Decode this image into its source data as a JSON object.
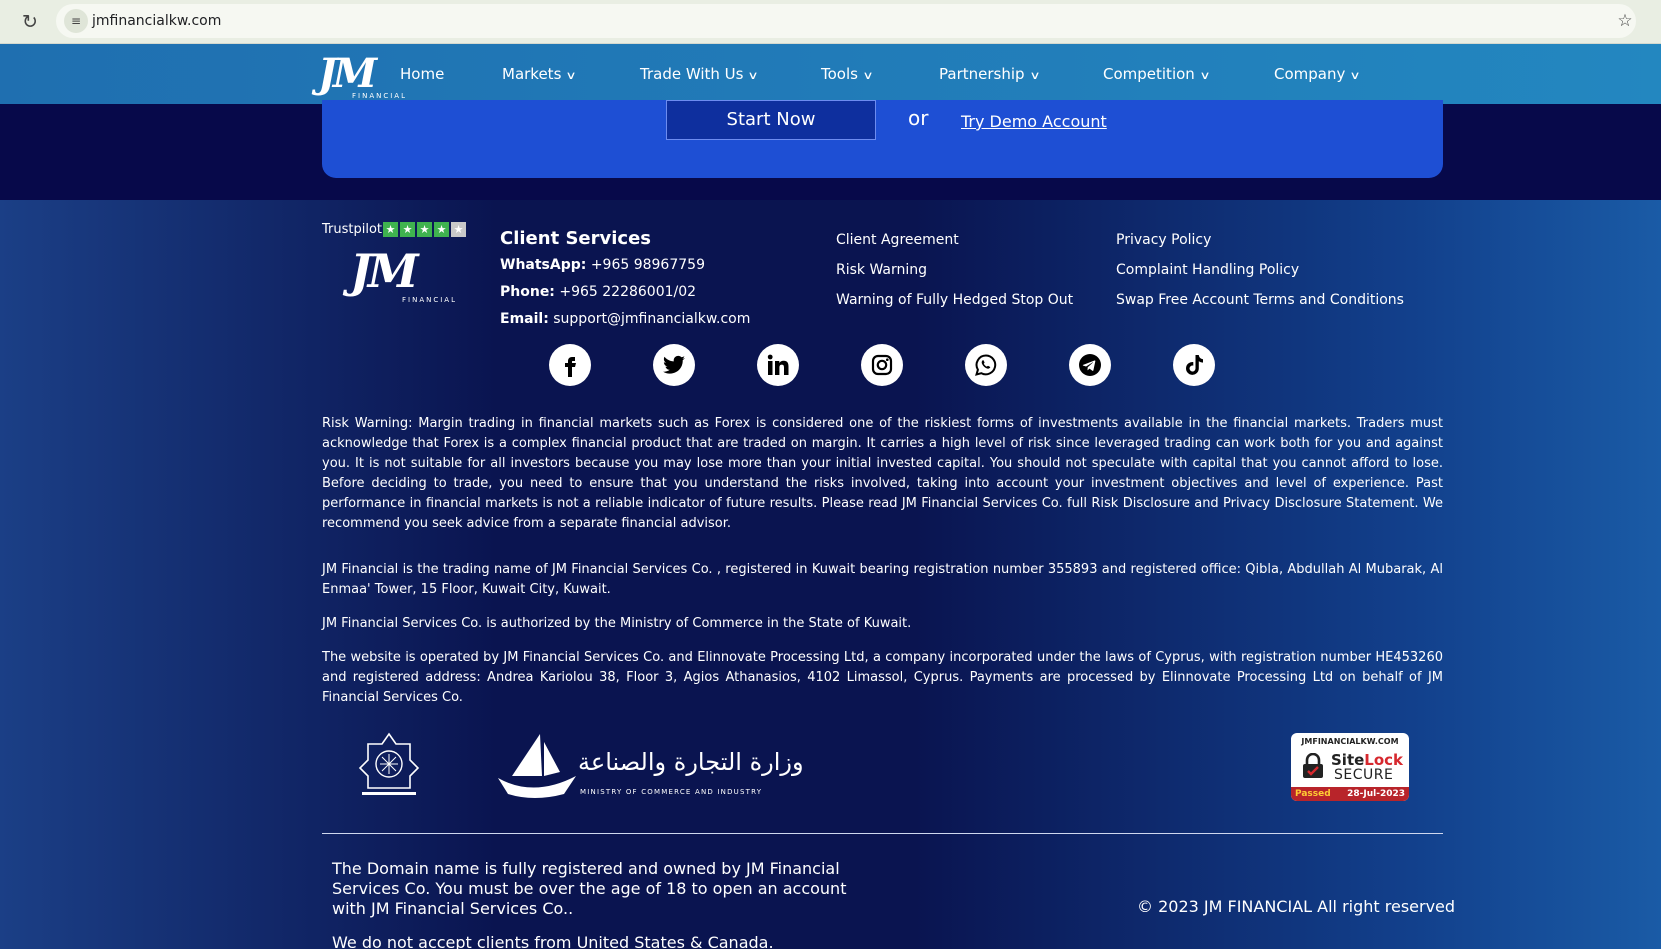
{
  "browser": {
    "url": "jmfinancialkw.com"
  },
  "nav": {
    "logo_text": "JM",
    "logo_sub": "FINANCIAL",
    "items": [
      {
        "label": "Home",
        "has_dropdown": false
      },
      {
        "label": "Markets",
        "has_dropdown": true
      },
      {
        "label": "Trade With Us",
        "has_dropdown": true
      },
      {
        "label": "Tools",
        "has_dropdown": true
      },
      {
        "label": "Partnership",
        "has_dropdown": true
      },
      {
        "label": "Competition",
        "has_dropdown": true
      },
      {
        "label": "Company",
        "has_dropdown": true
      }
    ]
  },
  "cta": {
    "start_label": "Start Now",
    "or_label": "or",
    "demo_label": "Try Demo Account"
  },
  "footer": {
    "trustpilot_label": "Trustpilot",
    "trustpilot_rating": 4,
    "client_services": {
      "title": "Client Services",
      "whatsapp_label": "WhatsApp:",
      "whatsapp": "+965 98967759",
      "phone_label": "Phone:",
      "phone": "+965 22286001/02",
      "email_label": "Email:",
      "email": "support@jmfinancialkw.com"
    },
    "links_col1": [
      "Client Agreement",
      "Risk Warning",
      "Warning of Fully Hedged Stop Out"
    ],
    "links_col2": [
      "Privacy Policy",
      "Complaint Handling Policy",
      "Swap Free Account Terms and Conditions"
    ],
    "social": [
      "facebook-icon",
      "twitter-icon",
      "linkedin-icon",
      "instagram-icon",
      "whatsapp-icon",
      "telegram-icon",
      "tiktok-icon"
    ],
    "risk_warning": "Risk Warning: Margin trading in financial markets such as Forex is considered one of the riskiest forms of investments available in the financial markets. Traders must acknowledge that Forex is a complex financial product that are traded on margin. It carries a high level of risk since leveraged trading can work both for you and against you. It is not suitable for all investors because you may lose more than your initial invested capital. You should not speculate with capital that you cannot afford to lose. Before deciding to trade, you need to ensure that you understand the risks involved, taking into account your investment objectives and level of experience. Past performance in financial markets is not a reliable indicator of future results. Please read JM Financial Services Co. full Risk Disclosure and Privacy Disclosure Statement. We recommend you seek advice from a separate financial advisor.",
    "trading_name": "JM Financial is the trading name of JM Financial Services Co. , registered in Kuwait bearing registration number 355893 and registered office: Qibla, Abdullah Al Mubarak, Al Enmaa' Tower, 15 Floor, Kuwait City, Kuwait.",
    "authorized": "JM Financial Services Co. is authorized  by the Ministry of Commerce in the State of Kuwait.",
    "operated": "The website is operated by JM Financial Services Co. and Elinnovate Processing Ltd, a company incorporated under the laws of Cyprus, with registration number HE453260 and registered address: Andrea Kariolou 38, Floor 3, Agios Athanasios, 4102 Limassol, Cyprus. Payments are processed by Elinnovate Processing Ltd on behalf of JM Financial Services Co.",
    "ministry_ar": "وزارة التجارة والصناعة",
    "ministry_en": "MINISTRY OF COMMERCE AND INDUSTRY",
    "sitelock": {
      "domain": "JMFINANCIALKW.COM",
      "brand_a": "Site",
      "brand_b": "Lock",
      "secure": "SECURE",
      "passed": "Passed",
      "date": "28-Jul-2023"
    },
    "domain_note": "The Domain name is fully registered and owned by JM Financial Services Co. You must be over the age of 18 to open an account with JM Financial Services Co..",
    "no_us": "We do not accept clients from United States & Canada.",
    "copyright": "© 2023 JM FINANCIAL All right reserved"
  }
}
